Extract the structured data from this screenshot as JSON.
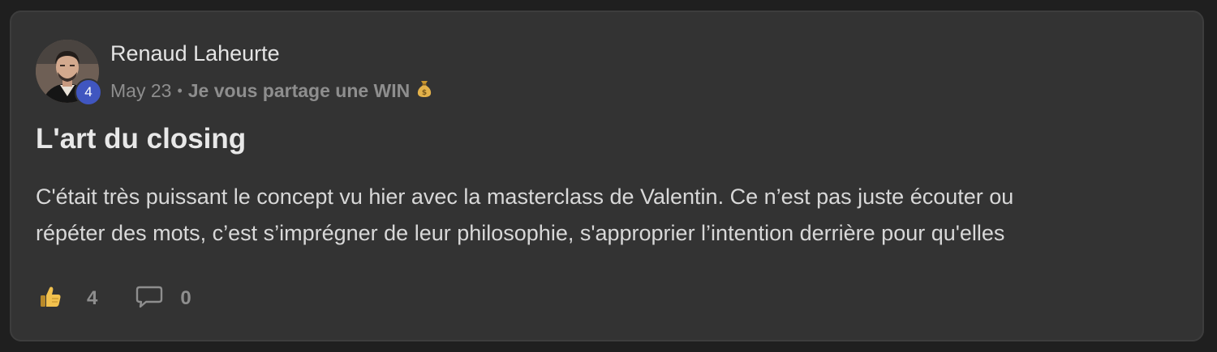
{
  "post": {
    "author": {
      "name": "Renaud Laheurte",
      "level": "4"
    },
    "meta": {
      "date": "May 23",
      "separator": "•",
      "category": "Je vous partage une WIN",
      "category_icon": "money-bag-icon"
    },
    "title": "L'art du closing",
    "body": {
      "line1": "C'était très puissant le concept vu hier avec la masterclass de Valentin. Ce n’est pas juste écouter ou",
      "line2": "répéter des mots, c’est s’imprégner de leur philosophie, s'approprier l’intention derrière pour qu'elles"
    },
    "actions": {
      "like_icon": "thumbs-up-icon",
      "like_count": "4",
      "comment_icon": "comment-icon",
      "comment_count": "0"
    }
  },
  "colors": {
    "page_background": "#1f1f1f",
    "card_background": "#333333",
    "level_badge": "#4056c0",
    "muted_text": "#8e8e8e",
    "thumbs_up": "#f2c14e"
  }
}
